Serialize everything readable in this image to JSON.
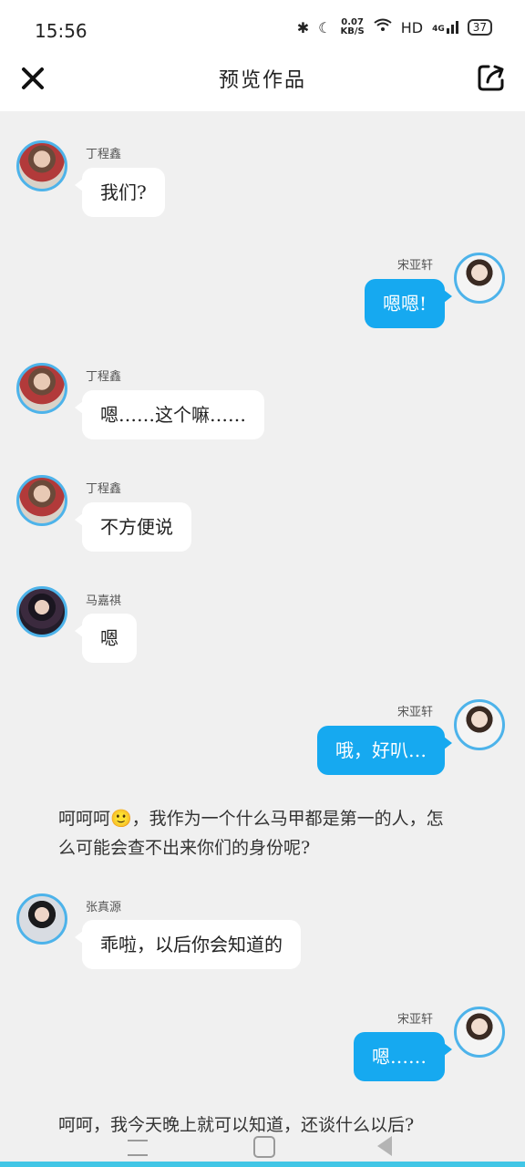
{
  "status_bar": {
    "time": "15:56",
    "speed_value": "0.07",
    "speed_unit": "KB/S",
    "hd": "HD",
    "signal_label": "4G",
    "battery": "37"
  },
  "header": {
    "title": "预览作品"
  },
  "messages": [
    {
      "side": "left",
      "avatar": "ding",
      "name": "丁程鑫",
      "text": "我们?"
    },
    {
      "side": "right",
      "avatar": "song",
      "name": "宋亚轩",
      "text": "嗯嗯!"
    },
    {
      "side": "left",
      "avatar": "ding",
      "name": "丁程鑫",
      "text": "嗯……这个嘛……"
    },
    {
      "side": "left",
      "avatar": "ding",
      "name": "丁程鑫",
      "text": "不方便说"
    },
    {
      "side": "left",
      "avatar": "ma",
      "name": "马嘉祺",
      "text": "嗯"
    },
    {
      "side": "right",
      "avatar": "song",
      "name": "宋亚轩",
      "text": "哦，好叭…"
    },
    {
      "side": "left",
      "avatar": "zhang",
      "name": "张真源",
      "text": "乖啦，以后你会知道的"
    },
    {
      "side": "right",
      "avatar": "song",
      "name": "宋亚轩",
      "text": "嗯……"
    }
  ],
  "narrations": [
    "呵呵呵🙂，我作为一个什么马甲都是第一的人，怎么可能会查不出来你们的身份呢?",
    "呵呵，我今天晚上就可以知道，还谈什么以后?"
  ],
  "colors": {
    "accent": "#16a9f0",
    "avatar_ring": "#4db3ea",
    "background": "#f0f0f0"
  },
  "icons": {
    "close": "close-icon",
    "share": "share-icon"
  }
}
